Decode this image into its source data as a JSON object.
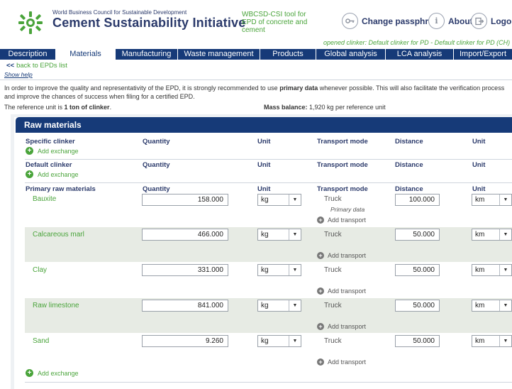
{
  "header": {
    "org_name": "World Business Council for Sustainable Development",
    "csi_name": "Cement Sustainability Initiative",
    "tool_desc": "WBCSD-CSI tool for EPD of concrete and cement",
    "change_pass": "Change passphrase",
    "about": "About",
    "logout": "Logout",
    "opened_clinker": "opened clinker: Default clinker for PD - Default clinker for PD (CH)"
  },
  "nav": {
    "tabs": [
      {
        "label": "Description"
      },
      {
        "label": "Materials"
      },
      {
        "label": "Manufacturing"
      },
      {
        "label": "Waste management"
      },
      {
        "label": "Products"
      },
      {
        "label": "Global analysis"
      },
      {
        "label": "LCA analysis"
      },
      {
        "label": "Import/Export"
      }
    ]
  },
  "subnav": {
    "back_arrow": "<<",
    "back_label": "back to EPDs list",
    "show_help": "Show help"
  },
  "intro": {
    "text_before": "In order to improve the quality and representativity of the EPD, it is strongly recommended to use ",
    "bold": "primary data",
    "text_after": " whenever possible. This will also facilitate the verification process and improve the chances of success when filing for a certified EPD.",
    "ref_prefix": "The reference unit is ",
    "ref_bold": "1 ton of clinker",
    "ref_suffix": ".",
    "mass_label": "Mass balance:",
    "mass_value": " 1,920 kg per reference unit"
  },
  "panel": {
    "title": "Raw materials",
    "columns": {
      "quantity": "Quantity",
      "unit": "Unit",
      "transport": "Transport mode",
      "distance": "Distance",
      "dist_unit": "Unit"
    },
    "add_exchange": "Add exchange",
    "add_transport": "Add transport",
    "sections": {
      "specific": "Specific clinker",
      "default": "Default clinker",
      "primary": "Primary raw materials"
    },
    "materials": [
      {
        "name": "Bauxite",
        "quantity": "158.000",
        "unit": "kg",
        "transport": "Truck",
        "note": "Primary data",
        "distance": "100.000",
        "dist_unit": "km"
      },
      {
        "name": "Calcareous marl",
        "quantity": "466.000",
        "unit": "kg",
        "transport": "Truck",
        "note": "",
        "distance": "50.000",
        "dist_unit": "km"
      },
      {
        "name": "Clay",
        "quantity": "331.000",
        "unit": "kg",
        "transport": "Truck",
        "note": "",
        "distance": "50.000",
        "dist_unit": "km"
      },
      {
        "name": "Raw limestone",
        "quantity": "841.000",
        "unit": "kg",
        "transport": "Truck",
        "note": "",
        "distance": "50.000",
        "dist_unit": "km"
      },
      {
        "name": "Sand",
        "quantity": "9.260",
        "unit": "kg",
        "transport": "Truck",
        "note": "",
        "distance": "50.000",
        "dist_unit": "km"
      }
    ]
  }
}
